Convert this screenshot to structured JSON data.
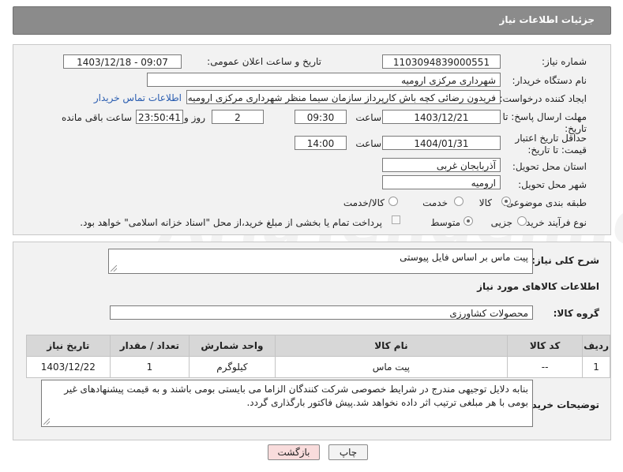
{
  "header": {
    "title": "جزئیات اطلاعات نیاز"
  },
  "fields": {
    "need_number_label": "شماره نیاز:",
    "need_number": "1103094839000551",
    "announce_label": "تاریخ و ساعت اعلان عمومی:",
    "announce_value": "1403/12/18 - 09:07",
    "buyer_org_label": "نام دستگاه خریدار:",
    "buyer_org": "شهرداری مرکزی ارومیه",
    "creator_label": "ایجاد کننده درخواست:",
    "creator": "فریدون رضائی کچه باش کارپرداز سازمان سیما منظر شهرداری مرکزی ارومیه",
    "contact_link": "اطلاعات تماس خریدار",
    "deadline_label": "مهلت ارسال پاسخ: تا تاریخ:",
    "deadline_date": "1403/12/21",
    "time_label": "ساعت",
    "deadline_time": "09:30",
    "days_value": "2",
    "days_label": "روز و",
    "remaining_time": "23:50:41",
    "remaining_label": "ساعت باقی مانده",
    "validity_label": "حداقل تاریخ اعتبار قیمت: تا تاریخ:",
    "validity_date": "1404/01/31",
    "validity_time": "14:00",
    "province_label": "استان محل تحویل:",
    "province": "آذربایجان غربی",
    "city_label": "شهر محل تحویل:",
    "city": "ارومیه",
    "category_label": "طبقه بندی موضوعی:",
    "category_options": [
      "کالا",
      "خدمت",
      "کالا/خدمت"
    ],
    "process_label": "نوع فرآیند خرید :",
    "process_options": [
      "جزیی",
      "متوسط"
    ],
    "payment_note": "پرداخت تمام یا بخشی از مبلغ خرید،از محل \"اسناد خزانه اسلامی\" خواهد بود."
  },
  "details": {
    "desc_label": "شرح کلی نیاز:",
    "desc_value": "پیت ماس بر اساس فایل پیوستی",
    "goods_info_title": "اطلاعات کالاهای مورد نیاز",
    "group_label": "گروه کالا:",
    "group_value": "محصولات کشاورزی",
    "table_headers": [
      "ردیف",
      "کد کالا",
      "نام کالا",
      "واحد شمارش",
      "تعداد / مقدار",
      "تاریخ نیاز"
    ],
    "table_rows": [
      [
        "1",
        "--",
        "پیت ماس",
        "کیلوگرم",
        "1",
        "1403/12/22"
      ]
    ],
    "buyer_notes_label": "توضیحات خریدار:",
    "buyer_notes": "بنابه دلایل توجیهی مندرج در شرایط خصوصی شرکت کنندگان الزاما می بایستی بومی باشند و به قیمت پیشنهادهای غیر بومی با هر مبلغی ترتیب اثر داده نخواهد شد.پیش فاکتور بارگذاری گردد."
  },
  "buttons": {
    "print": "چاپ",
    "back": "بازگشت"
  },
  "watermark": "AriaTender.neT",
  "colors": {
    "header_bg": "#8b8b8b",
    "link": "#2a5db0",
    "back_button_bg": "#f9dcdc"
  }
}
